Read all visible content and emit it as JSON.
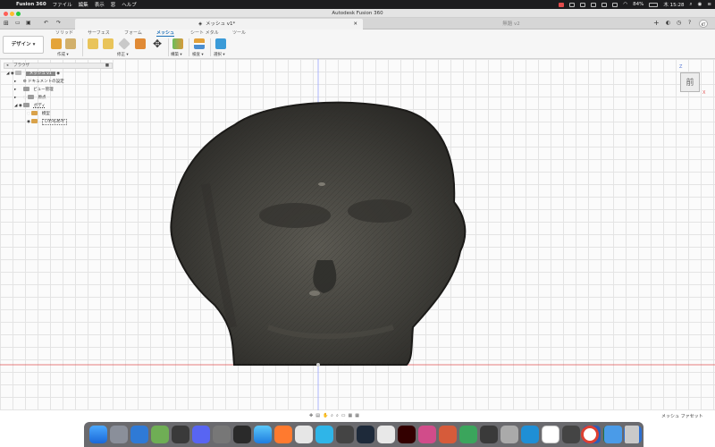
{
  "menubar": {
    "app_name": "Fusion 360",
    "items": [
      "ファイル",
      "編集",
      "表示",
      "窓",
      "ヘルプ"
    ],
    "battery": "84%",
    "clock": "木 15:28",
    "user_initials": "KT"
  },
  "window": {
    "title": "Autodesk Fusion 360"
  },
  "tabs": {
    "active": "メッシュ v1*",
    "inactive": "無題 v2"
  },
  "ribbon": {
    "workspace": "デザイン",
    "tabs": [
      "ソリッド",
      "サーフェス",
      "フォーム",
      "メッシュ",
      "シート メタル",
      "ツール"
    ],
    "active_tab": "メッシュ",
    "groups": [
      "作成",
      "修正",
      "構築",
      "検査",
      "選択"
    ]
  },
  "browser": {
    "header": "ブラウザ",
    "items": [
      {
        "label": "メッシュ v1",
        "type": "root"
      },
      {
        "label": "ドキュメントの設定",
        "type": "folder"
      },
      {
        "label": "ビュー管理",
        "type": "folder"
      },
      {
        "label": "原点",
        "type": "folder"
      },
      {
        "label": "ボディ",
        "type": "folder"
      },
      {
        "label": "模型",
        "type": "body"
      },
      {
        "label": "いわもめ々",
        "type": "body"
      }
    ]
  },
  "viewcube": {
    "face_label": "前",
    "axis_z": "Z",
    "axis_x": "X"
  },
  "status": {
    "selection_filter": "メッシュ ファセット"
  },
  "colors": {
    "accent": "#1b6fb8",
    "axis_red": "#e05555",
    "model_dark": "#3a3935"
  }
}
